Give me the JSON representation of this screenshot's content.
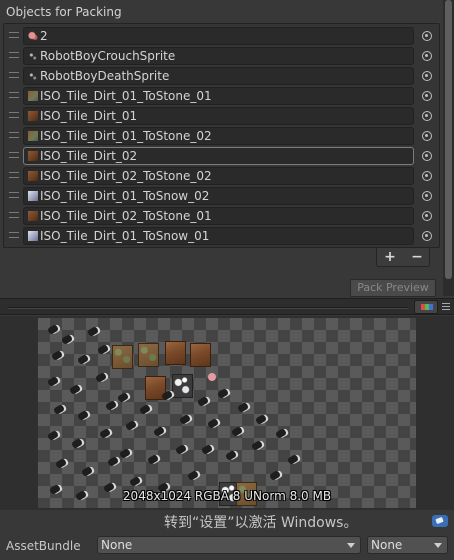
{
  "packables": {
    "title": "Objects for Packing",
    "items": [
      {
        "label": "2",
        "icon": "sprite-atlas-icon"
      },
      {
        "label": "RobotBoyCrouchSprite",
        "icon": "sprite-icon"
      },
      {
        "label": "RobotBoyDeathSprite",
        "icon": "sprite-icon"
      },
      {
        "label": "ISO_Tile_Dirt_01_ToStone_01",
        "icon": "texture-icon"
      },
      {
        "label": "ISO_Tile_Dirt_01",
        "icon": "texture-icon"
      },
      {
        "label": "ISO_Tile_Dirt_01_ToStone_02",
        "icon": "texture-icon"
      },
      {
        "label": "ISO_Tile_Dirt_02",
        "icon": "texture-icon"
      },
      {
        "label": "ISO_Tile_Dirt_02_ToStone_02",
        "icon": "texture-icon"
      },
      {
        "label": "ISO_Tile_Dirt_01_ToSnow_02",
        "icon": "texture-icon"
      },
      {
        "label": "ISO_Tile_Dirt_02_ToStone_01",
        "icon": "texture-icon"
      },
      {
        "label": "ISO_Tile_Dirt_01_ToSnow_01",
        "icon": "texture-icon"
      }
    ],
    "add_label": "+",
    "remove_label": "−"
  },
  "pack_preview_label": "Pack Preview",
  "preview": {
    "info": "2048x1024 RGBA 8 UNorm  8.0 MB",
    "channel_colors": [
      "#e04a4a",
      "#4ac04a",
      "#4a6ae0"
    ]
  },
  "watermark": "转到“设置”以激活 Windows。",
  "footer": {
    "asset_bundle_label": "AssetBundle",
    "bundle_value": "None",
    "variant_value": "None"
  },
  "colors": {
    "panel_bg": "#383838",
    "field_bg": "#2a2a2a",
    "selected_border": "#7c7c7c",
    "accent_blue": "#3b6fb5"
  }
}
